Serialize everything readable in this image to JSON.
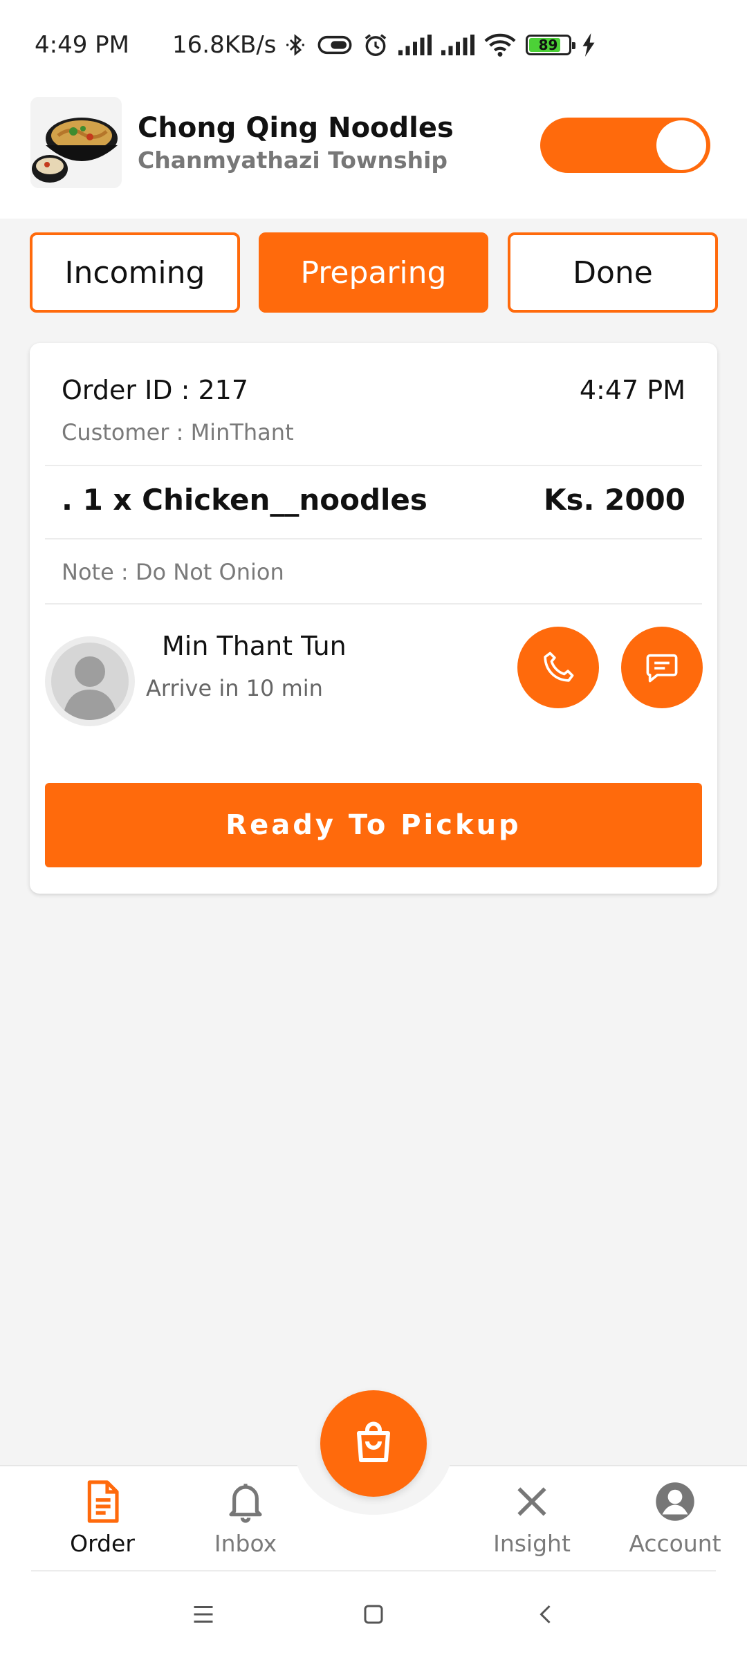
{
  "status_bar": {
    "time": "4:49 PM",
    "network_speed": "16.8KB/s",
    "battery_level": "89",
    "icons": [
      "bluetooth-icon",
      "vpn-icon",
      "alarm-icon",
      "signal-icon",
      "signal-icon",
      "wifi-icon",
      "battery-icon",
      "charging-icon"
    ]
  },
  "store": {
    "name": "Chong Qing Noodles",
    "township": "Chanmyathazi Township",
    "online": true
  },
  "tabs": [
    {
      "label": "Incoming",
      "active": false
    },
    {
      "label": "Preparing",
      "active": true
    },
    {
      "label": "Done",
      "active": false
    }
  ],
  "order": {
    "id_text": "Order ID : 217",
    "time": "4:47 PM",
    "customer_text": "Customer : MinThant",
    "item_text": ". 1 x Chicken__noodles",
    "price_text": "Ks. 2000",
    "note_text": "Note : Do Not Onion",
    "driver": {
      "name": "Min Thant Tun",
      "eta_text": "Arrive in 10 min"
    },
    "action_label": "Ready To Pickup"
  },
  "bottom_nav": {
    "items": [
      {
        "label": "Order",
        "icon": "document-icon",
        "active": true
      },
      {
        "label": "Inbox",
        "icon": "bell-icon",
        "active": false
      },
      {
        "label": "Insight",
        "icon": "close-icon",
        "active": false
      },
      {
        "label": "Account",
        "icon": "account-icon",
        "active": false
      }
    ],
    "center_icon": "shopping-bag-icon"
  },
  "colors": {
    "accent": "#ff6a0c",
    "background": "#f4f4f4"
  }
}
